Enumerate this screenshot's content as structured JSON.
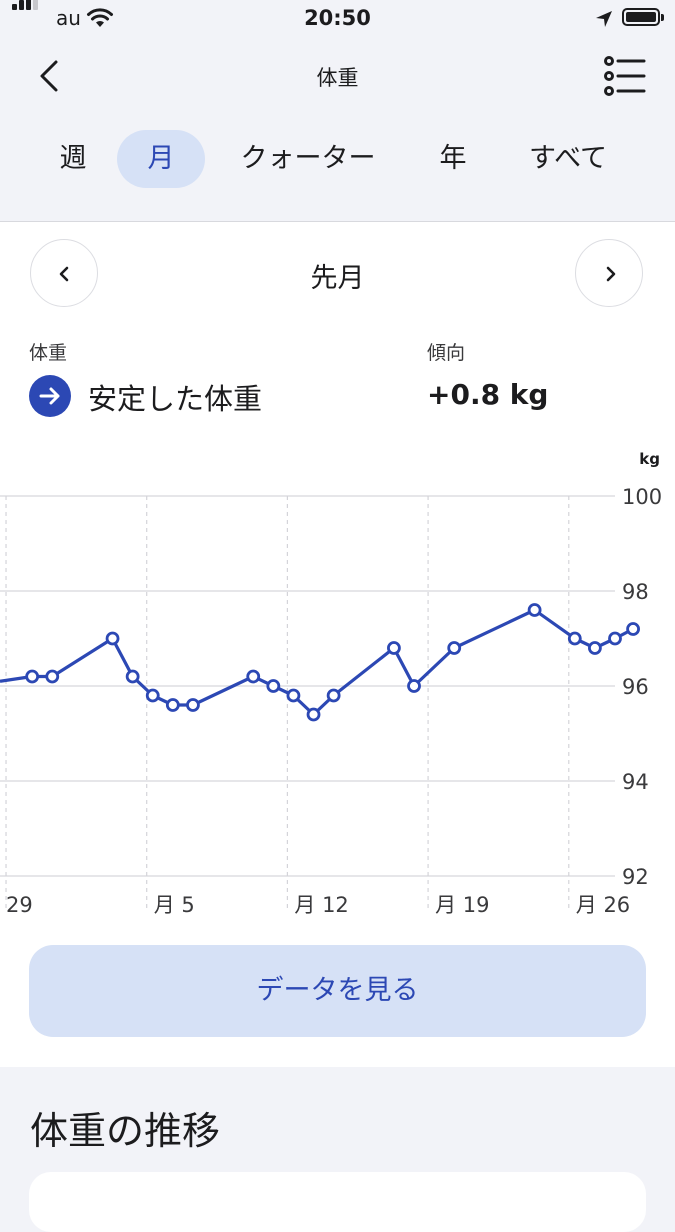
{
  "status": {
    "carrier": "au",
    "time": "20:50"
  },
  "nav": {
    "title": "体重",
    "back_icon": "chevron-left-icon",
    "menu_icon": "list-icon"
  },
  "tabs": [
    {
      "label": "週",
      "active": false
    },
    {
      "label": "月",
      "active": true
    },
    {
      "label": "クォーター",
      "active": false
    },
    {
      "label": "年",
      "active": false
    },
    {
      "label": "すべて",
      "active": false
    }
  ],
  "period": {
    "label": "先月"
  },
  "summary": {
    "weight_label": "体重",
    "weight_value": "安定した体重",
    "trend_label": "傾向",
    "trend_value": "+0.8 kg",
    "trend_icon": "arrow-right-icon"
  },
  "colors": {
    "accent": "#2c48b4",
    "accent_light": "#d6e1f6",
    "background": "#f2f3f8"
  },
  "chart_data": {
    "type": "line",
    "unit_label": "kg",
    "ylim": [
      92,
      100
    ],
    "y_ticks": [
      100,
      98,
      96,
      94,
      92
    ],
    "x_ticks": [
      {
        "day": 29,
        "label": "29"
      },
      {
        "day": 36,
        "label": "月 5"
      },
      {
        "day": 43,
        "label": "月 12"
      },
      {
        "day": 50,
        "label": "月 19"
      },
      {
        "day": 57,
        "label": "月 26"
      }
    ],
    "grid": true,
    "x_range": [
      28.7,
      59.3
    ],
    "series": [
      {
        "points": [
          {
            "x": 28.7,
            "y": 96.1
          },
          {
            "x": 30.3,
            "y": 96.2
          },
          {
            "x": 31.3,
            "y": 96.2
          },
          {
            "x": 34.3,
            "y": 97.0
          },
          {
            "x": 35.3,
            "y": 96.2
          },
          {
            "x": 36.3,
            "y": 95.8
          },
          {
            "x": 37.3,
            "y": 95.6
          },
          {
            "x": 38.3,
            "y": 95.6
          },
          {
            "x": 41.3,
            "y": 96.2
          },
          {
            "x": 42.3,
            "y": 96.0
          },
          {
            "x": 43.3,
            "y": 95.8
          },
          {
            "x": 44.3,
            "y": 95.4
          },
          {
            "x": 45.3,
            "y": 95.8
          },
          {
            "x": 48.3,
            "y": 96.8
          },
          {
            "x": 49.3,
            "y": 96.0
          },
          {
            "x": 51.3,
            "y": 96.8
          },
          {
            "x": 55.3,
            "y": 97.6
          },
          {
            "x": 57.3,
            "y": 97.0
          },
          {
            "x": 58.3,
            "y": 96.8
          },
          {
            "x": 59.3,
            "y": 97.0
          },
          {
            "x": 60.2,
            "y": 97.2
          }
        ]
      }
    ]
  },
  "actions": {
    "view_data": "データを見る"
  },
  "section": {
    "title": "体重の推移"
  }
}
